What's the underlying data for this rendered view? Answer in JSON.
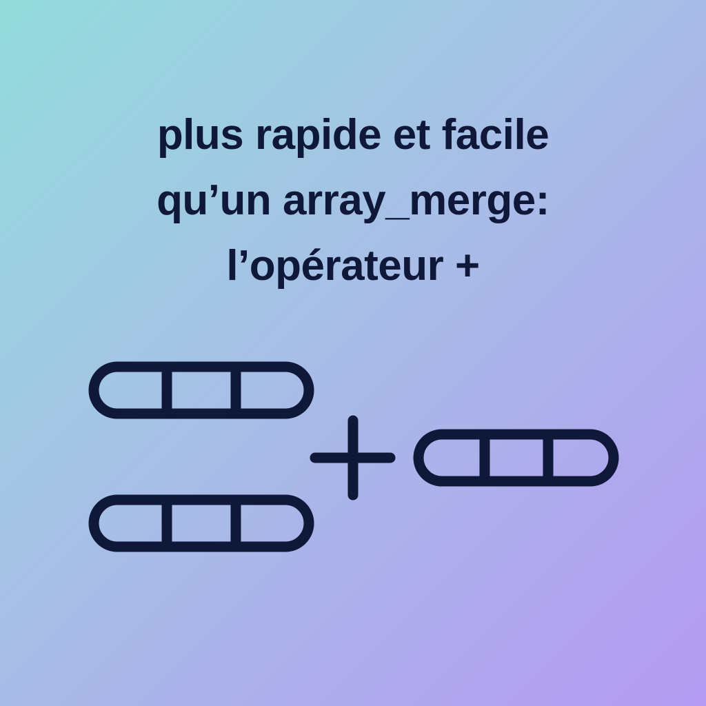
{
  "headline": {
    "line1": "plus rapide et facile",
    "line2": "qu’un array_merge:",
    "line3": "l’opérateur +"
  },
  "colors": {
    "ink": "#0f1838",
    "gradient_start": "#93dcdc",
    "gradient_end": "#b39bf2"
  },
  "illustration": {
    "arrays": [
      {
        "name": "array-left-top",
        "cells": 3
      },
      {
        "name": "array-left-bottom",
        "cells": 3
      },
      {
        "name": "array-right",
        "cells": 3
      }
    ],
    "operator_icon": "plus-icon"
  }
}
